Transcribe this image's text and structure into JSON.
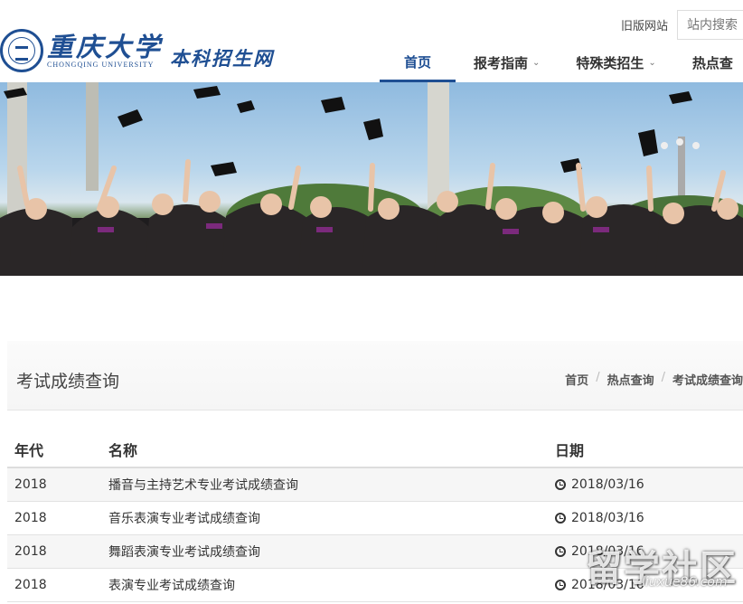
{
  "header": {
    "logo_cn": "重庆大学",
    "logo_en": "CHONGQING UNIVERSITY",
    "logo_sub": "本科招生网",
    "old_site": "旧版网站",
    "search_placeholder": "站内搜索"
  },
  "nav": {
    "items": [
      {
        "label": "首页",
        "active": true
      },
      {
        "label": "报考指南",
        "has_dropdown": true
      },
      {
        "label": "特殊类招生",
        "has_dropdown": true
      },
      {
        "label": "热点查"
      }
    ]
  },
  "page": {
    "title": "考试成绩查询",
    "breadcrumb": [
      "首页",
      "热点查询",
      "考试成绩查询"
    ]
  },
  "table": {
    "headers": [
      "年代",
      "名称",
      "日期"
    ],
    "rows": [
      {
        "year": "2018",
        "name": "播音与主持艺术专业考试成绩查询",
        "date": "2018/03/16"
      },
      {
        "year": "2018",
        "name": "音乐表演专业考试成绩查询",
        "date": "2018/03/16"
      },
      {
        "year": "2018",
        "name": "舞蹈表演专业考试成绩查询",
        "date": "2018/03/16"
      },
      {
        "year": "2018",
        "name": "表演专业考试成绩查询",
        "date": "2018/03/16"
      }
    ]
  },
  "watermark": {
    "main": "留学社区",
    "sub": "liuxue86.com"
  },
  "colors": {
    "brand": "#1f4f93"
  }
}
